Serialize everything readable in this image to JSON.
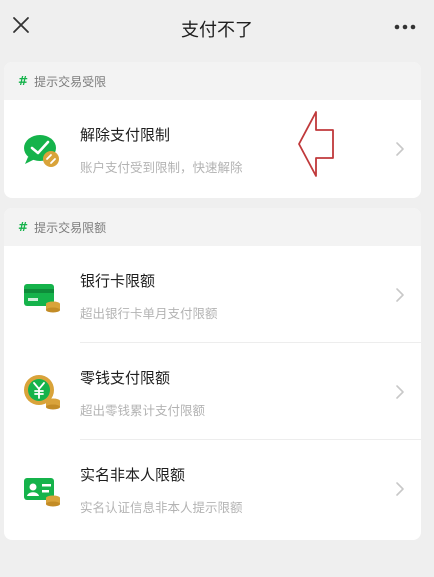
{
  "header": {
    "title": "支付不了"
  },
  "section1": {
    "title": "提示交易受限",
    "rows": [
      {
        "label": "解除支付限制",
        "desc": "账户支付受到限制，快速解除"
      }
    ]
  },
  "section2": {
    "title": "提示交易限额",
    "rows": [
      {
        "label": "银行卡限额",
        "desc": "超出银行卡单月支付限额"
      },
      {
        "label": "零钱支付限额",
        "desc": "超出零钱累计支付限额"
      },
      {
        "label": "实名非本人限额",
        "desc": "实名认证信息非本人提示限额"
      }
    ]
  },
  "colors": {
    "accent": "#15b34b",
    "icon_gold": "#d9a33a",
    "pointer": "#c0393b"
  }
}
